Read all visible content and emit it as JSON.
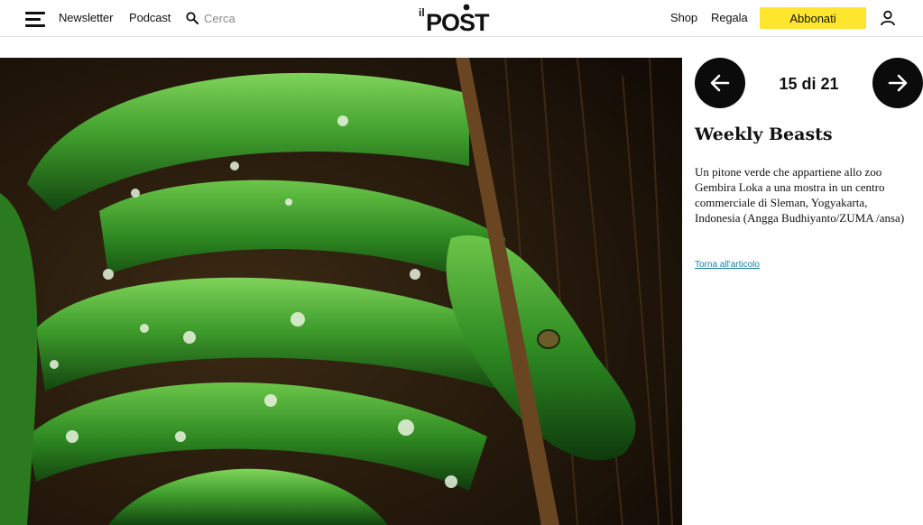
{
  "header": {
    "menu_icon": "hamburger-menu-icon",
    "newsletter_label": "Newsletter",
    "podcast_label": "Podcast",
    "search_icon": "search-icon",
    "search_placeholder": "Cerca",
    "search_value": "",
    "logo_text": "il POST",
    "shop_label": "Shop",
    "gift_label": "Regala",
    "subscribe_label": "Abbonati",
    "user_icon": "user-icon",
    "accent_color": "#ffe62e"
  },
  "gallery": {
    "prev_icon": "arrow-left-icon",
    "next_icon": "arrow-right-icon",
    "counter": "15 di 21",
    "title": "Weekly Beasts",
    "caption": "Un pitone verde che appartiene allo zoo Gembira Loka a una mostra in un centro commerciale di Sleman, Yogyakarta, Indonesia (Angga Budhiyanto/ZUMA /ansa)",
    "back_link": "Torna all'articolo",
    "link_color": "#1c7fa6",
    "image_subject": "green tree python coiled on a branch"
  }
}
